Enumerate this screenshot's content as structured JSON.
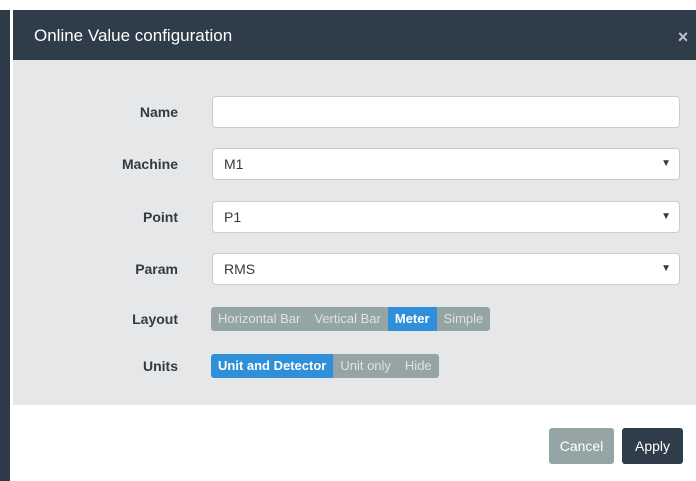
{
  "dialog": {
    "title": "Online Value configuration",
    "close_glyph": "×",
    "close_icon": "close-icon"
  },
  "form": {
    "name": {
      "label": "Name",
      "value": "",
      "placeholder": ""
    },
    "machine": {
      "label": "Machine",
      "value": "M1",
      "caret": "▼",
      "caret_icon": "chevron-down-icon"
    },
    "point": {
      "label": "Point",
      "value": "P1",
      "caret": "▼",
      "caret_icon": "chevron-down-icon"
    },
    "param": {
      "label": "Param",
      "value": "RMS",
      "caret": "▼",
      "caret_icon": "chevron-down-icon"
    },
    "layout": {
      "label": "Layout",
      "options": [
        "Horizontal Bar",
        "Vertical Bar",
        "Meter",
        "Simple"
      ],
      "selected": "Meter"
    },
    "units": {
      "label": "Units",
      "options": [
        "Unit and Detector",
        "Unit only",
        "Hide"
      ],
      "selected": "Unit and Detector"
    }
  },
  "footer": {
    "cancel_label": "Cancel",
    "apply_label": "Apply"
  },
  "colors": {
    "header_bg": "#2f3c49",
    "body_bg": "#e5e7e9",
    "active_segment": "#2f8fd8",
    "inactive_segment": "#95a5a6",
    "apply_bg": "#2f3c49",
    "cancel_bg": "#95a5a6"
  }
}
